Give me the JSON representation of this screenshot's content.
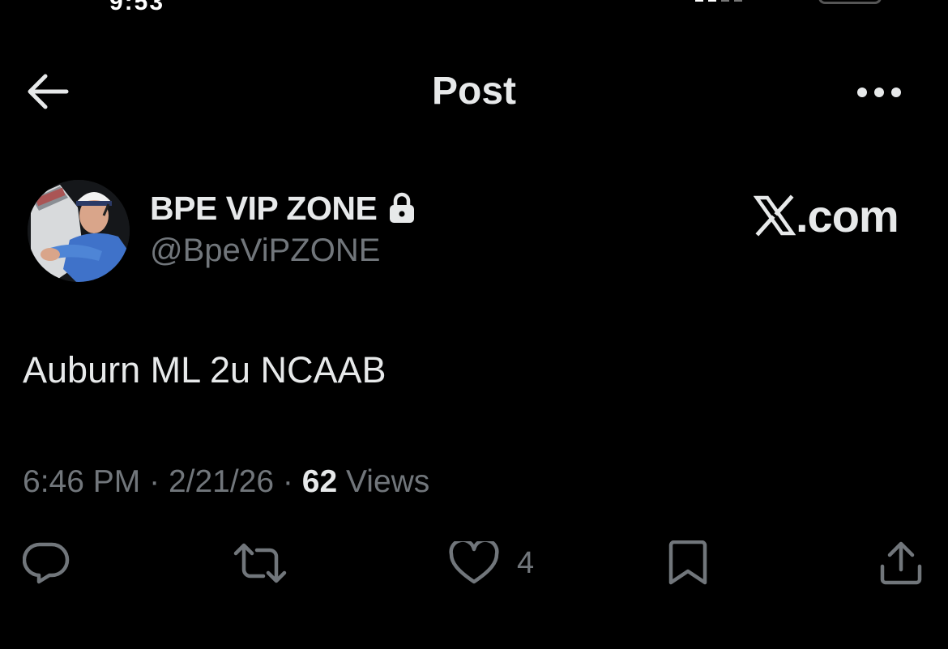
{
  "status_bar": {
    "time_partial": "9:53"
  },
  "header": {
    "title": "Post",
    "back_icon": "arrow-left-icon",
    "more_icon": "more-horizontal-icon"
  },
  "author": {
    "display_name": "BPE VIP ZONE",
    "handle": "@BpeViPZONE",
    "protected_icon": "lock-icon"
  },
  "watermark": {
    "brand_text": ".com",
    "logo_icon": "x-logo-icon"
  },
  "post": {
    "text": "Auburn ML 2u NCAAB",
    "time": "6:46 PM",
    "date": "2/21/26",
    "separator": "·",
    "views_count": "62",
    "views_label": "Views"
  },
  "actions": {
    "reply": {
      "icon": "reply-icon",
      "count": ""
    },
    "repost": {
      "icon": "repost-icon",
      "count": ""
    },
    "like": {
      "icon": "heart-icon",
      "count": "4"
    },
    "bookmark": {
      "icon": "bookmark-icon",
      "count": ""
    },
    "share": {
      "icon": "share-icon",
      "count": ""
    }
  },
  "colors": {
    "background": "#000000",
    "primary_text": "#e7e9ea",
    "secondary_text": "#71767b"
  }
}
